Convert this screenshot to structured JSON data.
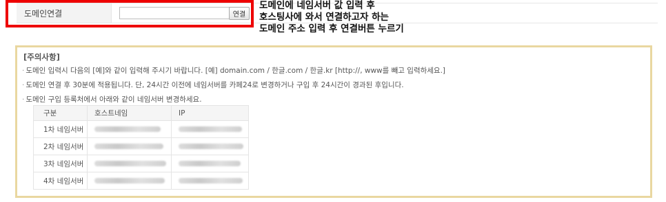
{
  "domain_form": {
    "label": "도메인연결",
    "input_value": "",
    "connect_button": "연결"
  },
  "annotation": {
    "line1": "도메인에 네임서버 값 입력 후",
    "line2": "호스팅사에 와서 연결하고자 하는",
    "line3": "도메인 주소 입력 후 연결버튼 누르기"
  },
  "notice": {
    "title": "[주의사항]",
    "lines": [
      "도메인 입력시 다음의 [예]와 같이 입력해 주시기 바랍니다. [예] domain.com / 한글.com / 한글.kr [http://, www를 빼고 입력하세요.]",
      "도메인 연결 후 30분에 적용됩니다. 단, 24시간 이전에 네임서버를 카페24로 변경하거나 구입 후 24시간이 경과된 후입니다.",
      "도메인 구입 등록처에서 아래와 같이 네임서버 변경하세요."
    ],
    "table": {
      "headers": [
        "구분",
        "호스트네임",
        "IP"
      ],
      "rows": [
        {
          "label": "1차 네임서버"
        },
        {
          "label": "2차 네임서버"
        },
        {
          "label": "3차 네임서버"
        },
        {
          "label": "4차 네임서버"
        }
      ]
    }
  },
  "colors": {
    "highlight_border": "#ee0000",
    "notice_border": "#e9d7a0"
  }
}
